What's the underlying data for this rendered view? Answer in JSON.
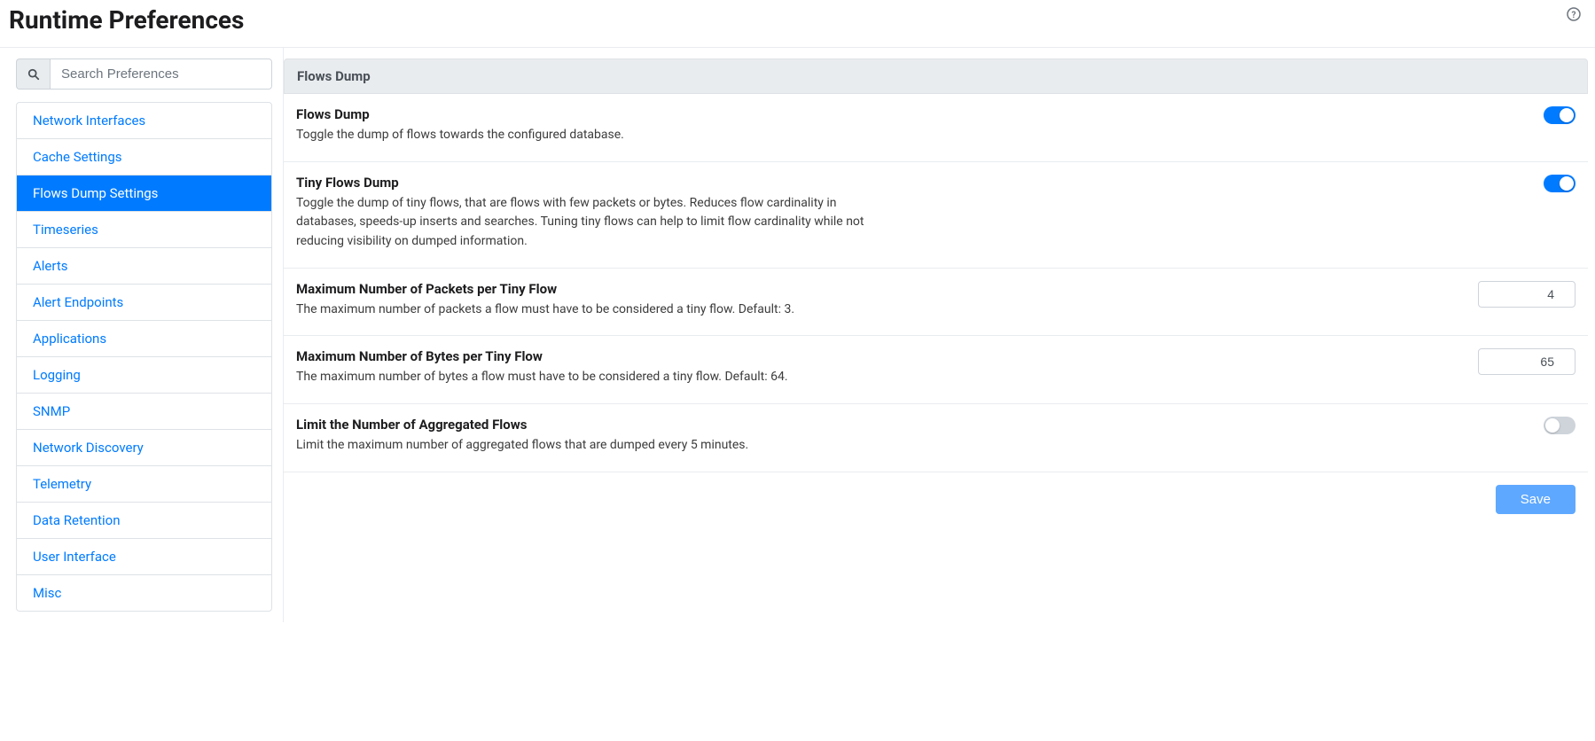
{
  "header": {
    "title": "Runtime Preferences"
  },
  "search": {
    "placeholder": "Search Preferences"
  },
  "sidebar": {
    "items": [
      {
        "label": "Network Interfaces",
        "active": false
      },
      {
        "label": "Cache Settings",
        "active": false
      },
      {
        "label": "Flows Dump Settings",
        "active": true
      },
      {
        "label": "Timeseries",
        "active": false
      },
      {
        "label": "Alerts",
        "active": false
      },
      {
        "label": "Alert Endpoints",
        "active": false
      },
      {
        "label": "Applications",
        "active": false
      },
      {
        "label": "Logging",
        "active": false
      },
      {
        "label": "SNMP",
        "active": false
      },
      {
        "label": "Network Discovery",
        "active": false
      },
      {
        "label": "Telemetry",
        "active": false
      },
      {
        "label": "Data Retention",
        "active": false
      },
      {
        "label": "User Interface",
        "active": false
      },
      {
        "label": "Misc",
        "active": false
      }
    ]
  },
  "panel": {
    "header": "Flows Dump",
    "settings": [
      {
        "id": "flows-dump",
        "title": "Flows Dump",
        "desc": "Toggle the dump of flows towards the configured database.",
        "type": "toggle",
        "value": true
      },
      {
        "id": "tiny-flows-dump",
        "title": "Tiny Flows Dump",
        "desc": "Toggle the dump of tiny flows, that are flows with few packets or bytes. Reduces flow cardinality in databases, speeds-up inserts and searches. Tuning tiny flows can help to limit flow cardinality while not reducing visibility on dumped information.",
        "type": "toggle",
        "value": true
      },
      {
        "id": "max-packets-tiny",
        "title": "Maximum Number of Packets per Tiny Flow",
        "desc": "The maximum number of packets a flow must have to be considered a tiny flow. Default: 3.",
        "type": "number",
        "value": "4"
      },
      {
        "id": "max-bytes-tiny",
        "title": "Maximum Number of Bytes per Tiny Flow",
        "desc": "The maximum number of bytes a flow must have to be considered a tiny flow. Default: 64.",
        "type": "number",
        "value": "65"
      },
      {
        "id": "limit-aggregated",
        "title": "Limit the Number of Aggregated Flows",
        "desc": "Limit the maximum number of aggregated flows that are dumped every 5 minutes.",
        "type": "toggle",
        "value": false
      }
    ],
    "save_label": "Save"
  }
}
